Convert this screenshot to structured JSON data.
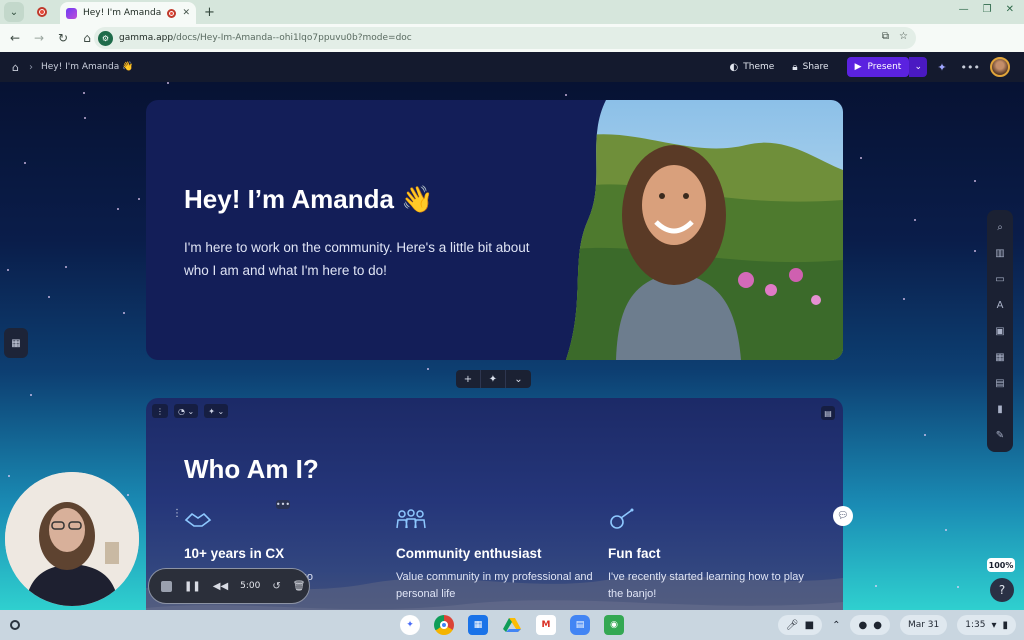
{
  "browser": {
    "tab_title": "Hey! I'm Amanda 👋",
    "url_host": "gamma.app",
    "url_path": "/docs/Hey-Im-Amanda--ohi1lqo7ppuvu0b?mode=doc"
  },
  "appbar": {
    "breadcrumb": "Hey! I'm Amanda 👋",
    "theme_label": "Theme",
    "share_label": "Share",
    "present_label": "Present"
  },
  "hero": {
    "title": "Hey! I’m Amanda",
    "wave": "👋",
    "body": "I'm here to work on the community. Here's a little bit about who I am and what I'm here to do!"
  },
  "about": {
    "title": "Who Am I?",
    "columns": [
      {
        "heading": "10+ years in CX",
        "body": "…uccess, …2.5 years ago",
        "icon": "handshake-icon"
      },
      {
        "heading": "Community enthusiast",
        "body": "Value community in my professional and personal life",
        "icon": "people-icon"
      },
      {
        "heading": "Fun fact",
        "body": "I've recently started learning how to play the banjo!",
        "icon": "banjo-icon"
      }
    ]
  },
  "zoom": "100%",
  "recorder": {
    "time": "5:00"
  },
  "shelf": {
    "date": "Mar 31",
    "time": "1:35"
  },
  "colors": {
    "accent": "#5b22e0",
    "card_bg": "#131e58",
    "shelf_bg": "#c9d6e0"
  }
}
